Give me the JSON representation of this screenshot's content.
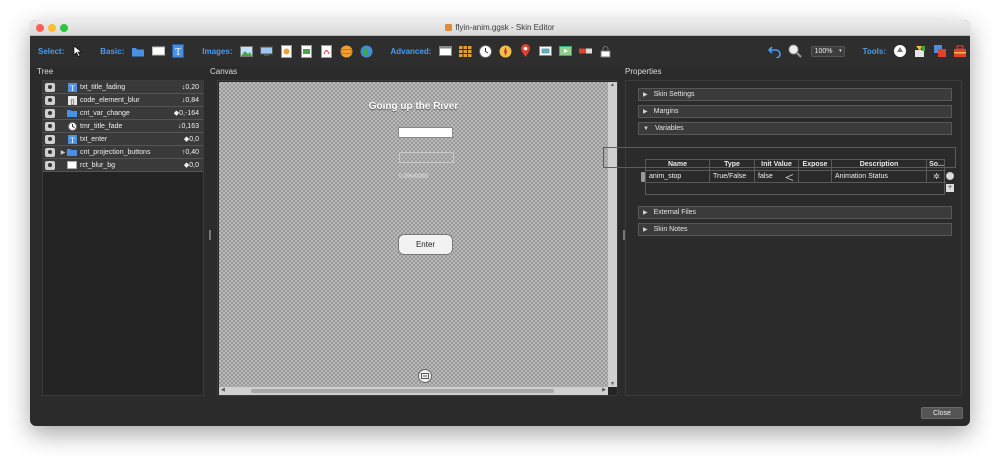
{
  "window": {
    "title": "flyin-anim.ggsk - Skin Editor"
  },
  "toolbar": {
    "select_label": "Select:",
    "basic_label": "Basic:",
    "images_label": "Images:",
    "advanced_label": "Advanced:",
    "zoom_value": "100%",
    "tools_label": "Tools:"
  },
  "panels": {
    "tree_title": "Tree",
    "canvas_title": "Canvas",
    "properties_title": "Properties"
  },
  "tree": {
    "items": [
      {
        "label": "txt_title_fading",
        "value": "↓0,20",
        "icon": "text-icon"
      },
      {
        "label": "code_element_blur",
        "value": "↓0,84",
        "icon": "code-icon"
      },
      {
        "label": "cnt_var_change",
        "value": "◆0,-164",
        "icon": "folder-icon"
      },
      {
        "label": "tmr_title_fade",
        "value": "↓0,163",
        "icon": "timer-icon"
      },
      {
        "label": "txt_enter",
        "value": "◆0,0",
        "icon": "text-icon"
      },
      {
        "label": "cnt_projection_buttons",
        "value": "↑0,40",
        "icon": "folder-icon"
      },
      {
        "label": "rct_blur_bg",
        "value": "◆0,0",
        "icon": "rectangle-icon"
      }
    ]
  },
  "canvas": {
    "heading": "Going up the River",
    "small_text": "0.0%/0000",
    "enter_label": "Enter"
  },
  "properties": {
    "sections": {
      "skin_settings": "Skin Settings",
      "margins": "Margins",
      "variables": "Variables",
      "external_files": "External Files",
      "skin_notes": "Skin Notes"
    },
    "variables_table": {
      "headers": {
        "name": "Name",
        "type": "Type",
        "init": "Init Value",
        "expose": "Expose",
        "description": "Description",
        "sort": "So..."
      },
      "row": {
        "name": "anim_stop",
        "type": "True/False",
        "init": "false",
        "expose": "",
        "description": "Animation Status"
      }
    }
  },
  "footer": {
    "close_label": "Close"
  },
  "colors": {
    "accent": "#4a9cf0",
    "highlight": "#d9262b"
  }
}
